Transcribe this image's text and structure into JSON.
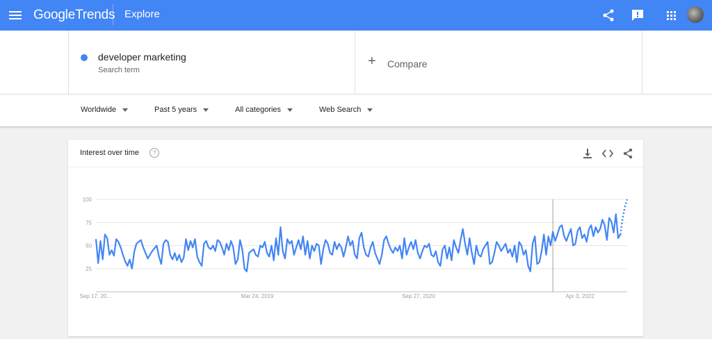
{
  "header": {
    "logo_google": "Google",
    "logo_trends": "Trends",
    "section": "Explore",
    "icons": [
      "menu-icon",
      "share-icon",
      "feedback-icon",
      "apps-icon",
      "account-avatar"
    ]
  },
  "search": {
    "term": "developer marketing",
    "term_type": "Search term",
    "term_color": "#4285f4",
    "compare_label": "Compare"
  },
  "filters": {
    "region": "Worldwide",
    "time": "Past 5 years",
    "category": "All categories",
    "property": "Web Search"
  },
  "card": {
    "title": "Interest over time",
    "help": "?",
    "icons": [
      "download-icon",
      "embed-icon",
      "share-icon"
    ]
  },
  "chart_data": {
    "type": "line",
    "title": "Interest over time",
    "xlabel": "",
    "ylabel": "",
    "ylim": [
      0,
      100
    ],
    "y_ticks": [
      25,
      50,
      75,
      100
    ],
    "x_tick_labels": [
      "Sep 17, 20…",
      "Mar 24, 2019",
      "Sep 27, 2020",
      "Apr 3, 2022"
    ],
    "grid": true,
    "legend": "none",
    "series": [
      {
        "color": "#4285f4",
        "values": [
          57,
          31,
          55,
          35,
          62,
          58,
          40,
          45,
          39,
          57,
          54,
          48,
          40,
          33,
          28,
          35,
          25,
          43,
          52,
          54,
          56,
          48,
          42,
          36,
          40,
          44,
          47,
          50,
          38,
          30,
          52,
          56,
          54,
          40,
          35,
          42,
          34,
          40,
          32,
          37,
          57,
          45,
          55,
          48,
          57,
          38,
          32,
          28,
          52,
          55,
          48,
          46,
          50,
          44,
          56,
          54,
          48,
          40,
          52,
          45,
          55,
          48,
          30,
          35,
          56,
          46,
          25,
          22,
          42,
          44,
          46,
          40,
          38,
          50,
          48,
          54,
          42,
          38,
          50,
          34,
          58,
          40,
          70,
          44,
          36,
          57,
          52,
          55,
          40,
          48,
          56,
          46,
          60,
          40,
          55,
          36,
          50,
          44,
          52,
          50,
          30,
          46,
          56,
          52,
          42,
          40,
          54,
          46,
          52,
          48,
          38,
          48,
          60,
          50,
          55,
          40,
          36,
          58,
          64,
          48,
          40,
          38,
          48,
          54,
          42,
          36,
          30,
          40,
          56,
          60,
          52,
          46,
          42,
          48,
          44,
          50,
          36,
          58,
          40,
          48,
          54,
          46,
          56,
          42,
          36,
          44,
          50,
          48,
          52,
          40,
          38,
          44,
          32,
          28,
          46,
          50,
          36,
          48,
          34,
          56,
          48,
          42,
          56,
          68,
          52,
          40,
          58,
          42,
          30,
          50,
          40,
          38,
          46,
          50,
          54,
          30,
          32,
          42,
          54,
          50,
          44,
          48,
          52,
          42,
          46,
          38,
          50,
          32,
          54,
          50,
          40,
          45,
          28,
          22,
          52,
          60,
          30,
          32,
          44,
          62,
          40,
          60,
          50,
          65,
          55,
          62,
          70,
          72,
          60,
          55,
          62,
          68,
          50,
          52,
          66,
          70,
          58,
          62,
          54,
          68,
          72,
          60,
          70,
          64,
          68,
          78,
          72,
          56,
          80,
          76,
          64,
          84,
          58,
          62,
          80,
          92,
          100
        ]
      }
    ],
    "forecast": true
  }
}
